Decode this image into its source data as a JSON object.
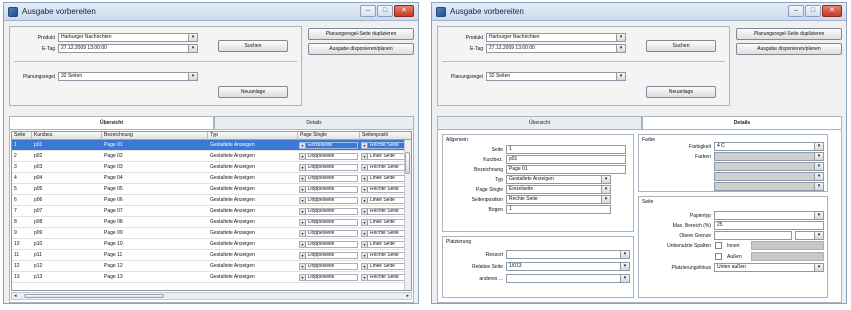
{
  "window_title": "Ausgabe vorbereiten",
  "window_buttons": {
    "minimize": "–",
    "maximize": "□",
    "close": "✕"
  },
  "header": {
    "produkt_label": "Produkt",
    "produkt_value": "Harburger Nachrichten",
    "etag_label": "E-Tag",
    "etag_value": "27.12.2009 13:00:00",
    "suchen_label": "Suchen",
    "planungsregel_label": "Planungsregel",
    "planungsregel_value": "32 Seiten",
    "neuanlage_label": "Neuanlage",
    "duplizieren_label": "Planungsregel-Seite duplizieren",
    "disponieren_label": "Ausgabe disponieren/planen"
  },
  "tabs": {
    "uebersicht": "Übersicht",
    "details": "Details"
  },
  "grid": {
    "columns": [
      "Seite",
      "Kurzbez.",
      "Bezeichnung",
      "Typ",
      "Page Single",
      "Seitenpositi"
    ],
    "rows": [
      {
        "seite": "1",
        "kurz": "p01",
        "bez": "Page 01",
        "typ": "Gestaltete Anzeigen",
        "single": "Einzelseite",
        "pos": "Rechte Seite",
        "selected": true
      },
      {
        "seite": "2",
        "kurz": "p02",
        "bez": "Page 02",
        "typ": "Gestaltete Anzeigen",
        "single": "Doppelseite",
        "pos": "Linke Seite"
      },
      {
        "seite": "3",
        "kurz": "p03",
        "bez": "Page 03",
        "typ": "Gestaltete Anzeigen",
        "single": "Doppelseite",
        "pos": "Rechte Seite"
      },
      {
        "seite": "4",
        "kurz": "p04",
        "bez": "Page 04",
        "typ": "Gestaltete Anzeigen",
        "single": "Doppelseite",
        "pos": "Linke Seite"
      },
      {
        "seite": "5",
        "kurz": "p05",
        "bez": "Page 05",
        "typ": "Gestaltete Anzeigen",
        "single": "Doppelseite",
        "pos": "Rechte Seite"
      },
      {
        "seite": "6",
        "kurz": "p06",
        "bez": "Page 06",
        "typ": "Gestaltete Anzeigen",
        "single": "Doppelseite",
        "pos": "Linke Seite"
      },
      {
        "seite": "7",
        "kurz": "p07",
        "bez": "Page 07",
        "typ": "Gestaltete Anzeigen",
        "single": "Doppelseite",
        "pos": "Rechte Seite"
      },
      {
        "seite": "8",
        "kurz": "p08",
        "bez": "Page 08",
        "typ": "Gestaltete Anzeigen",
        "single": "Doppelseite",
        "pos": "Linke Seite"
      },
      {
        "seite": "9",
        "kurz": "p09",
        "bez": "Page 09",
        "typ": "Gestaltete Anzeigen",
        "single": "Doppelseite",
        "pos": "Rechte Seite"
      },
      {
        "seite": "10",
        "kurz": "p10",
        "bez": "Page 10",
        "typ": "Gestaltete Anzeigen",
        "single": "Doppelseite",
        "pos": "Linke Seite"
      },
      {
        "seite": "11",
        "kurz": "p11",
        "bez": "Page 11",
        "typ": "Gestaltete Anzeigen",
        "single": "Doppelseite",
        "pos": "Rechte Seite"
      },
      {
        "seite": "12",
        "kurz": "p12",
        "bez": "Page 12",
        "typ": "Gestaltete Anzeigen",
        "single": "Doppelseite",
        "pos": "Linke Seite"
      },
      {
        "seite": "13",
        "kurz": "p13",
        "bez": "Page 13",
        "typ": "Gestaltete Anzeigen",
        "single": "Doppelseite",
        "pos": "Rechte Seite"
      }
    ]
  },
  "details": {
    "allgemein_label": "Allgemein",
    "seite_label": "Seite",
    "seite_value": "1",
    "kurzbez_label": "Kurzbez.",
    "kurzbez_value": "p01",
    "bezeichnung_label": "Bezeichnung",
    "bezeichnung_value": "Page 01",
    "typ_label": "Typ",
    "typ_value": "Gestaltete Anzeigen",
    "page_single_label": "Page Single",
    "page_single_value": "Einzelseite",
    "seitenposition_label": "Seitenposition",
    "seitenposition_value": "Rechte Seite",
    "bogen_label": "Bogen",
    "bogen_value": "1",
    "platzierung_label": "Platzierung",
    "ressort_label": "Ressort",
    "ressort_value": "",
    "relative_seite_label": "Relative Seite",
    "relative_seite_value": "1/013",
    "anderes_label": "anderes ...",
    "anderes_value": "",
    "farbe_label": "Farbe",
    "farbigkeit_label": "Farbigkeit",
    "farbigkeit_value": "4 C",
    "farben_label": "Farben",
    "seite_group_label": "Seite",
    "papiertyp_label": "Papiertyp",
    "papiertyp_value": "",
    "max_bereich_label": "Max. Bereich (%)",
    "max_bereich_value": "25",
    "obere_grenze_label": "Obere Grenze",
    "unbenutzte_label": "Unbenutzte Spalten",
    "innen_label": "Innen",
    "aussen_label": "Außen",
    "platzierungsfokus_label": "Platzierungsfokus",
    "platzierungsfokus_value": "Unten außen"
  },
  "colors": {
    "selection": "#3c78d6",
    "titlebar": "#cbdaee",
    "close": "#c63a22"
  }
}
